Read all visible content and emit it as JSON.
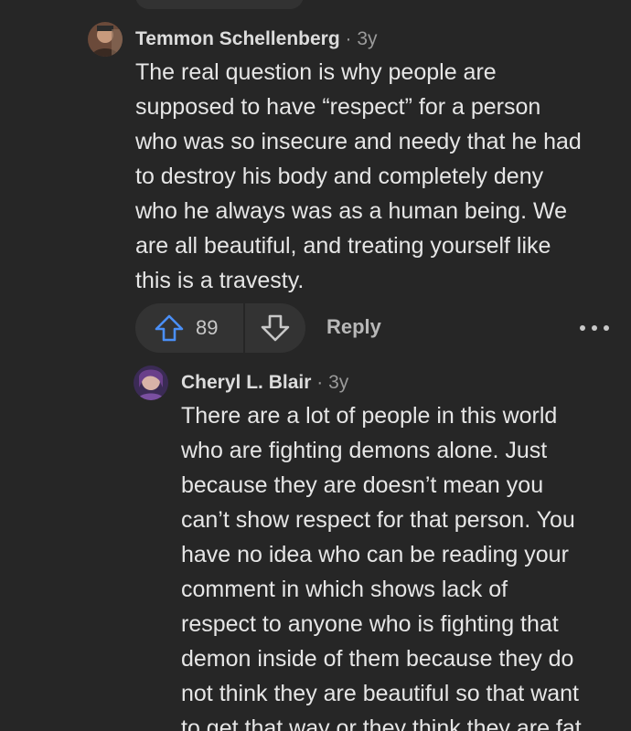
{
  "comments": [
    {
      "author": "Temmon Schellenberg",
      "separator": "·",
      "age": "3y",
      "lines": [
        "The real question is why people are",
        "supposed to have “respect” for a person",
        "who was so insecure and needy that he had",
        "to destroy his body and completely deny",
        "who he always was as a human being. We",
        "are all beautiful, and treating yourself like",
        "this is a travesty."
      ],
      "upvotes": "89",
      "reply_label": "Reply"
    },
    {
      "author": "Cheryl L. Blair",
      "separator": "·",
      "age": "3y",
      "lines": [
        "There are a lot of people in this world",
        "who are fighting demons alone. Just",
        "because they are doesn’t mean you",
        "can’t show respect for that person. You",
        "have no idea who can be reading your",
        "comment in which shows lack of",
        "respect to anyone who is fighting that",
        "demon inside of them because they do",
        "not think they are beautiful so that want",
        "to get that way or they think they are fat"
      ]
    }
  ],
  "icons": {
    "upvote": "arrow-up-icon",
    "downvote": "arrow-down-icon",
    "more": "more-horizontal-icon"
  },
  "colors": {
    "background": "#262626",
    "upvote_accent": "#4a8ff7",
    "pill": "#333333"
  }
}
